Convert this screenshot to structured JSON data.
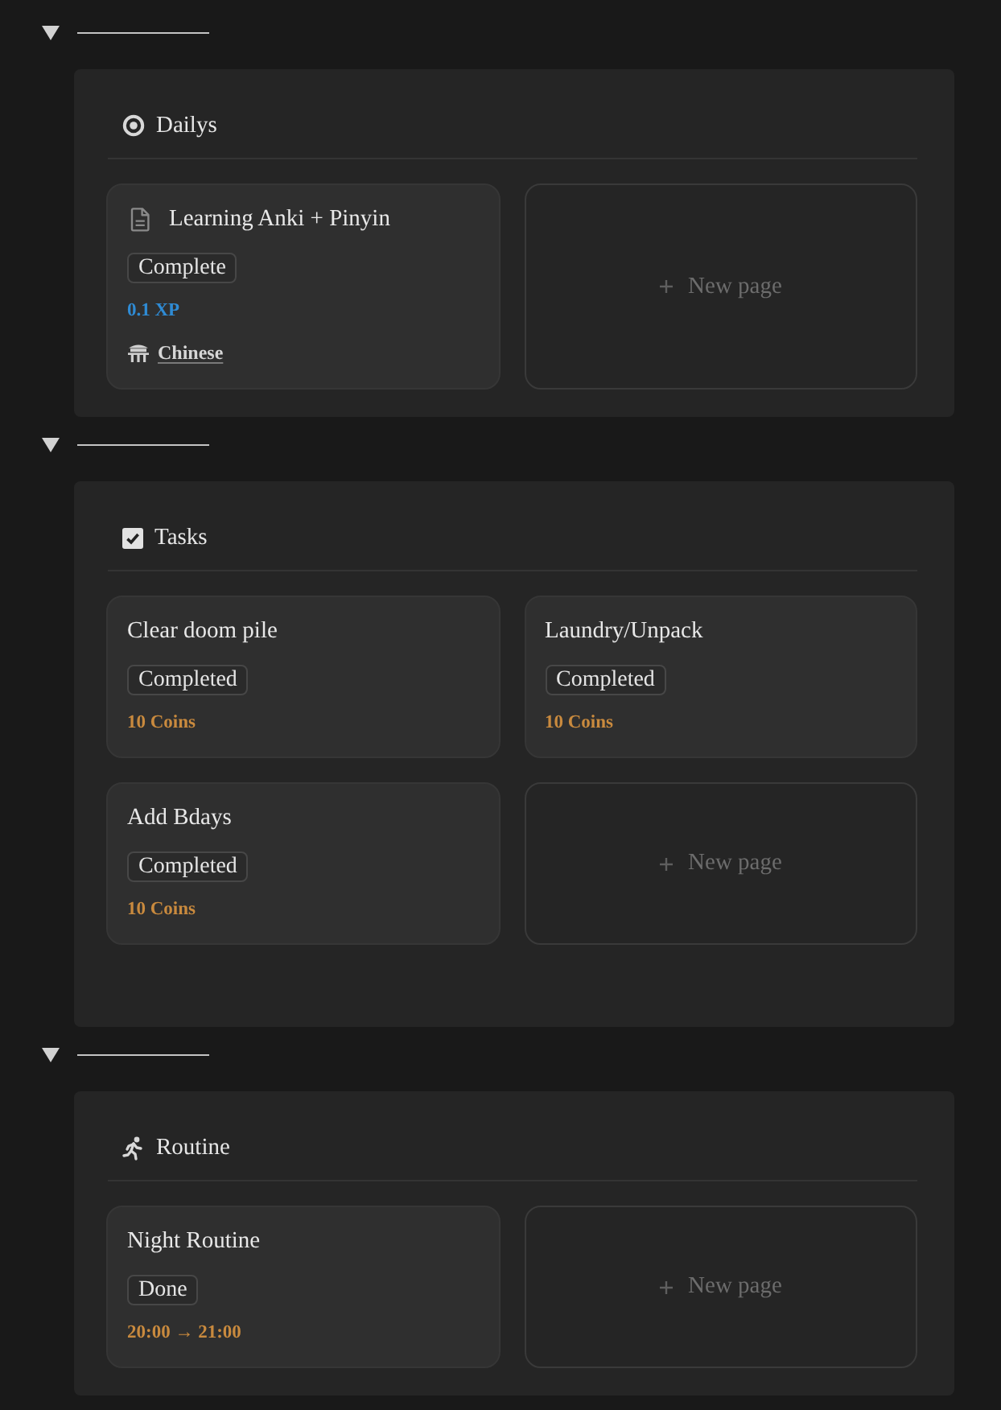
{
  "sections": [
    {
      "expanded": true,
      "title": "Dailys",
      "cards": [
        {
          "kind": "document",
          "title": "Learning Anki + Pinyin",
          "properties": [
            {
              "kind": "status",
              "text": "Complete"
            },
            {
              "kind": "value",
              "text": "0.1 XP",
              "color": "#2f8bd4"
            },
            {
              "kind": "relation",
              "text": "Chinese"
            }
          ]
        },
        {
          "kind": "add",
          "label": "New page"
        }
      ]
    },
    {
      "expanded": true,
      "title": "Tasks",
      "cards": [
        {
          "kind": "entry",
          "title": "Clear doom pile",
          "properties": [
            {
              "kind": "status",
              "text": "Completed"
            },
            {
              "kind": "value",
              "text": "10 Coins",
              "color": "#c98a3e"
            }
          ]
        },
        {
          "kind": "entry",
          "title": "Laundry/Unpack",
          "properties": [
            {
              "kind": "status",
              "text": "Completed"
            },
            {
              "kind": "value",
              "text": "10 Coins",
              "color": "#c98a3e"
            }
          ]
        },
        {
          "kind": "entry",
          "title": "Add Bdays",
          "properties": [
            {
              "kind": "status",
              "text": "Completed"
            },
            {
              "kind": "value",
              "text": "10 Coins",
              "color": "#c98a3e"
            }
          ]
        },
        {
          "kind": "add",
          "label": "New page"
        }
      ]
    },
    {
      "expanded": true,
      "title": "Routine",
      "cards": [
        {
          "kind": "entry",
          "title": "Night Routine",
          "properties": [
            {
              "kind": "status",
              "text": "Done"
            },
            {
              "kind": "value",
              "text": "20:00 → 21:00",
              "color": "#c98a3e"
            }
          ]
        },
        {
          "kind": "add",
          "label": "New page"
        }
      ]
    }
  ]
}
